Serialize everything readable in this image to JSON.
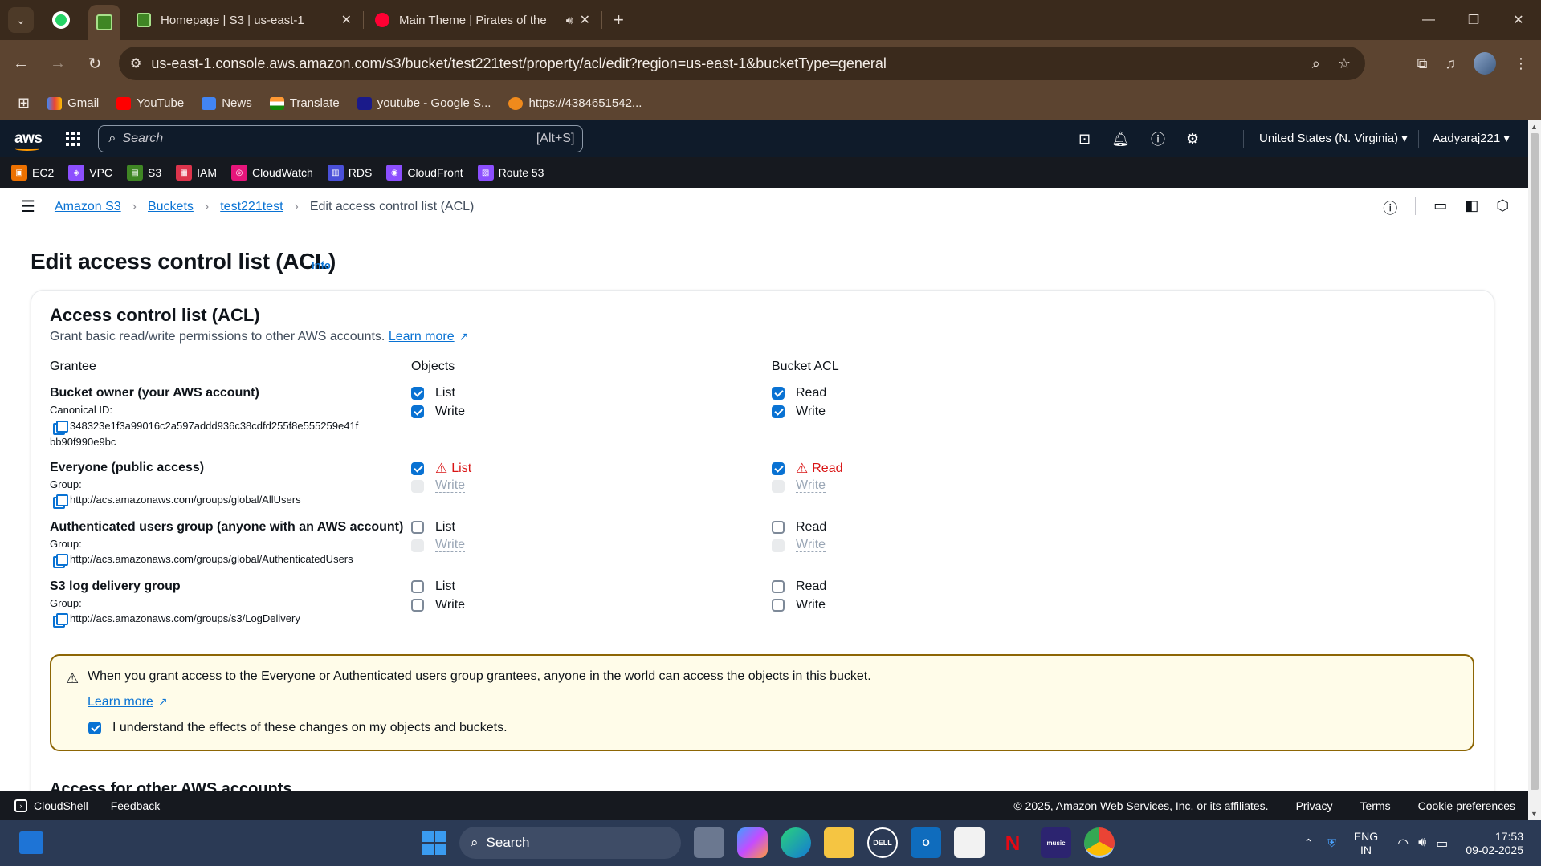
{
  "browser": {
    "tabs": [
      {
        "title": "Homepage | S3 | us-east-1"
      },
      {
        "title": "Main Theme | Pirates of the"
      }
    ],
    "url": "us-east-1.console.aws.amazon.com/s3/bucket/test221test/property/acl/edit?region=us-east-1&bucketType=general",
    "bookmarks": [
      "Gmail",
      "YouTube",
      "News",
      "Translate",
      "youtube - Google S...",
      "https://4384651542..."
    ]
  },
  "aws": {
    "logo": "aws",
    "search_placeholder": "Search",
    "search_shortcut": "[Alt+S]",
    "region": "United States (N. Virginia) ▾",
    "user": "Aadyaraj221 ▾",
    "services": [
      "EC2",
      "VPC",
      "S3",
      "IAM",
      "CloudWatch",
      "RDS",
      "CloudFront",
      "Route 53"
    ]
  },
  "breadcrumb": {
    "items": [
      "Amazon S3",
      "Buckets",
      "test221test"
    ],
    "current": "Edit access control list (ACL)"
  },
  "page": {
    "title": "Edit access control list (ACL)",
    "info": "Info"
  },
  "panel": {
    "heading": "Access control list (ACL)",
    "description": "Grant basic read/write permissions to other AWS accounts.",
    "learn_more": "Learn more",
    "columns": {
      "grantee": "Grantee",
      "objects": "Objects",
      "bucket_acl": "Bucket ACL"
    },
    "grantees": [
      {
        "name": "Bucket owner (your AWS account)",
        "sub": "Canonical ID:",
        "id": "348323e1f3a99016c2a597addd936c38cdfd255f8e555259e41f",
        "id2": "bb90f990e9bc",
        "obj": [
          {
            "label": "List"
          },
          {
            "label": "Write"
          }
        ],
        "acl": [
          {
            "label": "Read"
          },
          {
            "label": "Write"
          }
        ]
      },
      {
        "name": "Everyone (public access)",
        "sub": "Group:",
        "id": "http://acs.amazonaws.com/groups/global/AllUsers",
        "obj": [
          {
            "label": "List"
          },
          {
            "label": "Write"
          }
        ],
        "acl": [
          {
            "label": "Read"
          },
          {
            "label": "Write"
          }
        ]
      },
      {
        "name": "Authenticated users group (anyone with an AWS account)",
        "sub": "Group:",
        "id": "http://acs.amazonaws.com/groups/global/AuthenticatedUsers",
        "obj": [
          {
            "label": "List"
          },
          {
            "label": "Write"
          }
        ],
        "acl": [
          {
            "label": "Read"
          },
          {
            "label": "Write"
          }
        ]
      },
      {
        "name": "S3 log delivery group",
        "sub": "Group:",
        "id": "http://acs.amazonaws.com/groups/s3/LogDelivery",
        "obj": [
          {
            "label": "List"
          },
          {
            "label": "Write"
          }
        ],
        "acl": [
          {
            "label": "Read"
          },
          {
            "label": "Write"
          }
        ]
      }
    ],
    "alert": {
      "text": "When you grant access to the Everyone or Authenticated users group grantees, anyone in the world can access the objects in this bucket.",
      "learn_more": "Learn more",
      "ack": "I understand the effects of these changes on my objects and buckets."
    },
    "next_section": "Access for other AWS accounts"
  },
  "footer": {
    "cloudshell": "CloudShell",
    "feedback": "Feedback",
    "copyright": "© 2025, Amazon Web Services, Inc. or its affiliates.",
    "privacy": "Privacy",
    "terms": "Terms",
    "cookies": "Cookie preferences"
  },
  "taskbar": {
    "search": "Search",
    "lang1": "ENG",
    "lang2": "IN",
    "time": "17:53",
    "date": "09-02-2025"
  },
  "colors": {
    "link": "#0972d3",
    "warning": "#d91515",
    "aws_header": "#0f1b2a"
  }
}
